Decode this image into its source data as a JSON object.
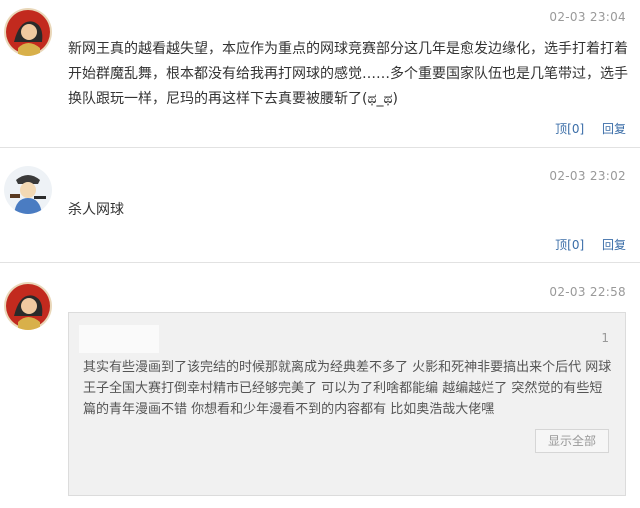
{
  "comments": [
    {
      "time": "02-03 23:04",
      "text": "新网王真的越看越失望，本应作为重点的网球竞赛部分这几年是愈发边缘化，选手打着打着开始群魔乱舞，根本都没有给我再打网球的感觉……多个重要国家队伍也是几笔带过，选手换队跟玩一样，尼玛的再这样下去真要被腰斩了(ಥ_ಥ)",
      "reply_top": "顶[0]",
      "reply": "回复"
    },
    {
      "time": "02-03 23:02",
      "text": "杀人网球",
      "reply_top": "顶[0]",
      "reply": "回复"
    },
    {
      "time": "02-03 22:58",
      "quote": {
        "floor": "1",
        "text": "其实有些漫画到了该完结的时候那就离成为经典差不多了 火影和死神非要搞出来个后代 网球王子全国大赛打倒幸村精市已经够完美了 可以为了利啥都能编 越编越烂了 突然觉的有些短篇的青年漫画不错 你想看和少年漫看不到的内容都有 比如奥浩哉大佬嘿",
        "show_all": "显示全部"
      }
    }
  ],
  "colors": {
    "link": "#3b6ea8",
    "meta": "#999999",
    "quote_bg": "#f1f1f1"
  }
}
